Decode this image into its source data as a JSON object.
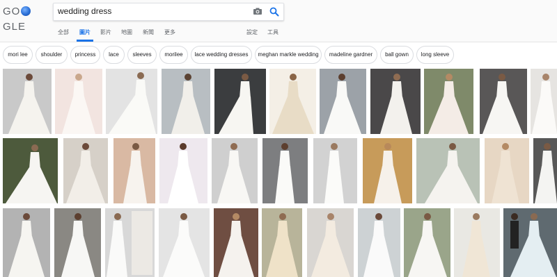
{
  "logo": {
    "text_left": "GO",
    "text_right": "GLE"
  },
  "search": {
    "value": "wedding dress"
  },
  "tabs": {
    "all": "全部",
    "images": "圖片",
    "videos": "影片",
    "maps": "地圖",
    "news": "新聞",
    "more": "更多",
    "settings": "設定",
    "tools": "工具"
  },
  "chips": [
    "mori lee",
    "shoulder",
    "princess",
    "lace",
    "sleeves",
    "morilee",
    "lace wedding dresses",
    "meghan markle wedding",
    "madeline gardner",
    "ball gown",
    "long sleeve"
  ],
  "colors": {
    "accent": "#1a73e8",
    "chip_border": "#dadce0",
    "tab_text": "#5f6368"
  },
  "icons": {
    "camera": "camera-icon",
    "search": "search-icon"
  }
}
